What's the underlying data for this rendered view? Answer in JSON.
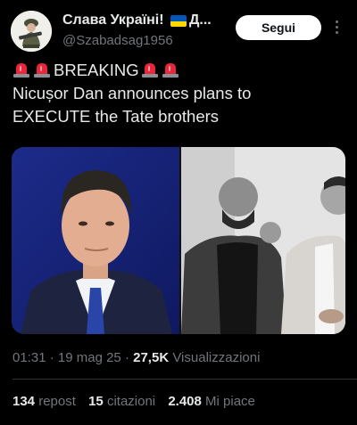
{
  "author": {
    "display_name": "Слава Україні!",
    "name_ellipsis": "Д...",
    "handle": "@Szabadsag1956",
    "flag_icon": "ukraine-flag-emoji"
  },
  "follow_label": "Segui",
  "tweet": {
    "line1_text": "BREAKING",
    "line2": "Nicușor Dan announces plans to",
    "line3": "EXECUTE the Tate brothers",
    "emoji": "police-car-light"
  },
  "meta": {
    "time": "01:31",
    "sep1": " · ",
    "date": "19 mag 25",
    "sep2": " · ",
    "views_count": "27,5K",
    "views_label": "Visualizzazioni"
  },
  "stats": {
    "reposts_count": "134",
    "reposts_label": "repost",
    "quotes_count": "15",
    "quotes_label": "citazioni",
    "likes_count": "2.408",
    "likes_label": "Mi piace"
  },
  "colors": {
    "background": "#000000",
    "text": "#e7e9ea",
    "muted": "#71767b",
    "divider": "#2f3336"
  }
}
